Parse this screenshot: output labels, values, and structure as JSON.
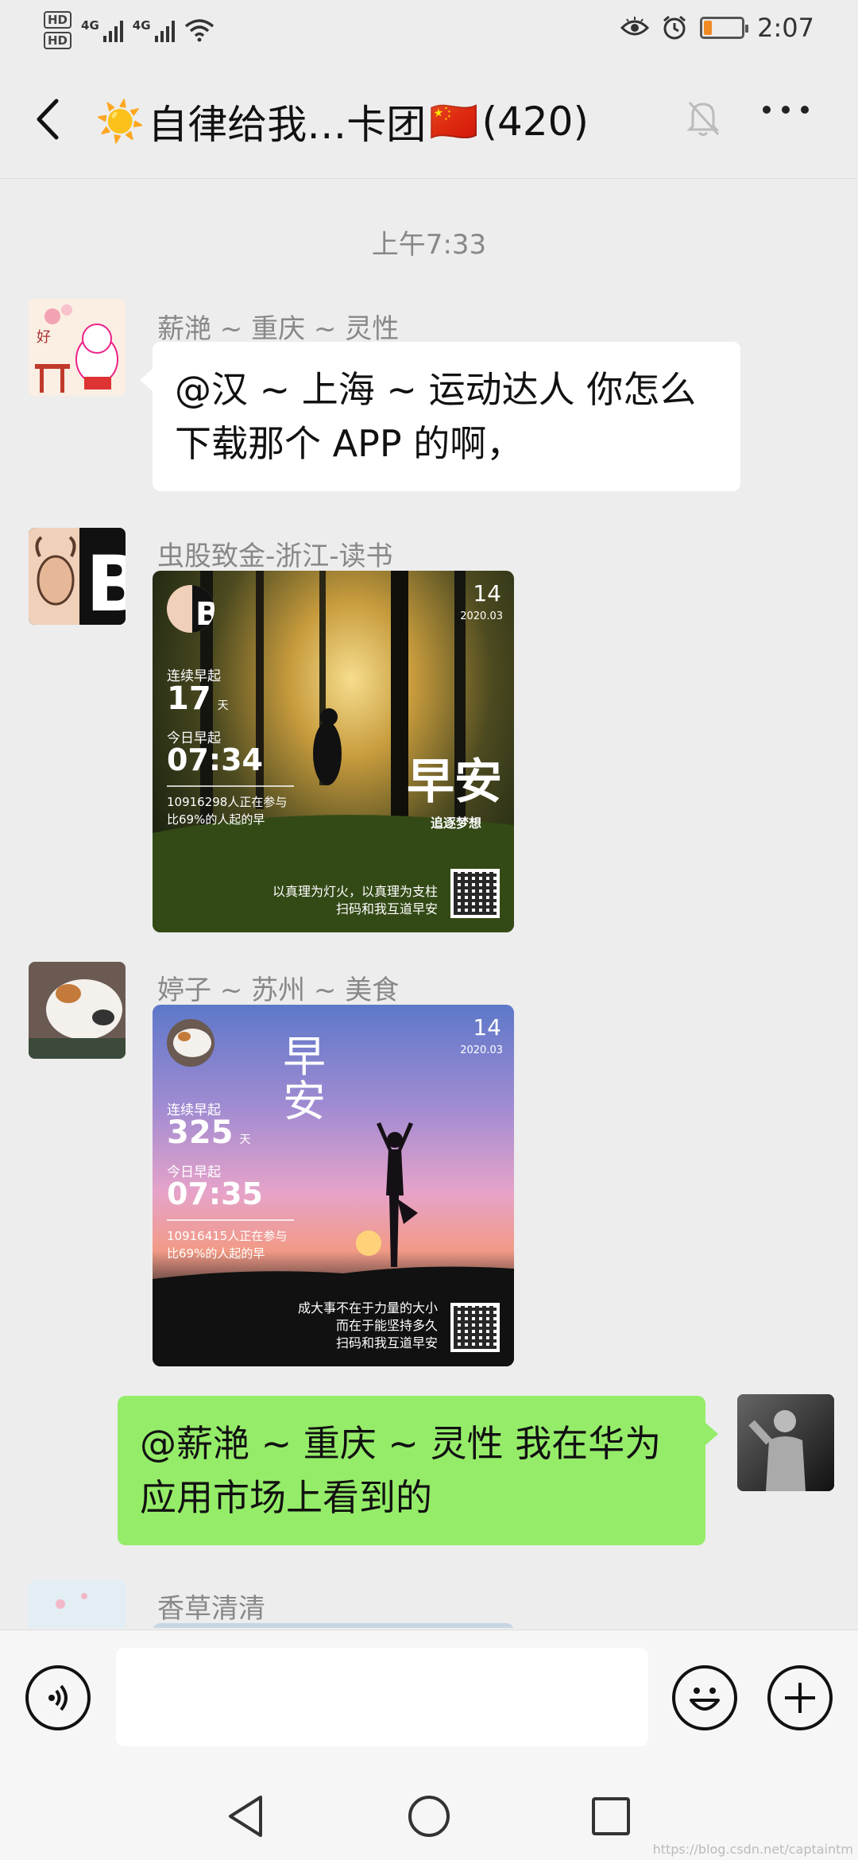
{
  "status_bar": {
    "hd1": "HD",
    "hd2": "HD",
    "sig1": "4G",
    "sig2": "4G",
    "time": "2:07",
    "battery_level": 0.2,
    "battery_color": "#f08a24"
  },
  "header": {
    "title": "自律给我…卡团",
    "member_count": "(420)",
    "title_emoji_prefix": "☀️",
    "title_emoji_suffix": "🇨🇳",
    "icons": [
      "back-arrow-icon",
      "mute-bell-icon",
      "more-icon"
    ]
  },
  "chat": {
    "time_divider": "上午7:33",
    "messages": [
      {
        "sender": "薪滟 ~ 重庆 ~ 灵性",
        "line1": "@汉 ~ 上海 ~ 运动达人  你怎么",
        "line2": "下载那个 APP 的啊，"
      },
      {
        "sender": "虫股致金-浙江-读书",
        "card": {
          "day": "14",
          "ym": "2020.03",
          "streak_label": "连续早起",
          "streak": "17",
          "unit": "天",
          "today_label": "今日早起",
          "today": "07:34",
          "stats1": "10916298人正在参与",
          "stats2": "比69%的人起的早",
          "brush_text": "早安",
          "brush_sub": "追逐梦想",
          "quote1": "以真理为灯火，以真理为支柱",
          "quote2": "扫码和我互道早安"
        }
      },
      {
        "sender": "婷子 ~ 苏州 ~ 美食",
        "card": {
          "day": "14",
          "ym": "2020.03",
          "streak_label": "连续早起",
          "streak": "325",
          "unit": "天",
          "today_label": "今日早起",
          "today": "07:35",
          "stats1": "10916415人正在参与",
          "stats2": "比69%的人起的早",
          "brush_text": "早安",
          "quote1": "成大事不在于力量的大小",
          "quote2": "而在于能坚持多久",
          "quote3": "扫码和我互道早安"
        }
      },
      {
        "self": true,
        "line1": "@薪滟 ~ 重庆 ~ 灵性  我在华为",
        "line2": "应用市场上看到的"
      },
      {
        "sender": "香草清清"
      }
    ]
  },
  "input_bar": {
    "placeholder": "",
    "icons": [
      "voice-icon",
      "emoji-icon",
      "plus-icon"
    ]
  },
  "system_nav": {
    "icons": [
      "back-triangle-icon",
      "home-circle-icon",
      "recents-square-icon"
    ]
  },
  "watermark": "https://blog.csdn.net/captaintm",
  "colors": {
    "self_bubble": "#95ec69",
    "background": "#ededed",
    "bubble": "#ffffff"
  }
}
